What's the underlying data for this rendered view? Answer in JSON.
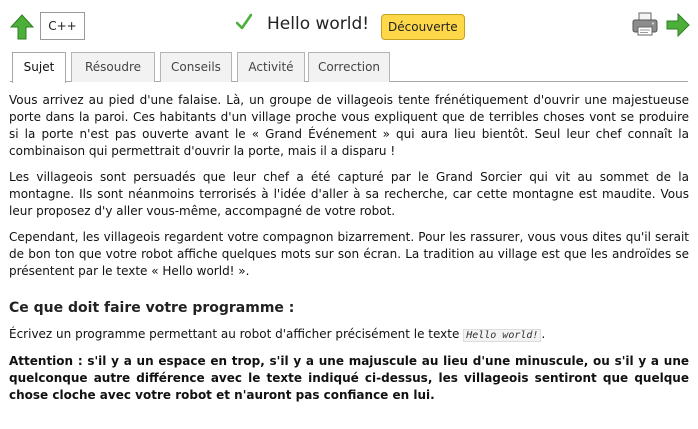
{
  "header": {
    "language": "C++",
    "title": "Hello world!",
    "level_badge": "Découverte"
  },
  "colors": {
    "accent_green": "#4caf3a",
    "badge_yellow": "#ffd84a"
  },
  "icons": {
    "back": "up-arrow-icon",
    "status": "checkmark-icon",
    "print": "printer-icon",
    "next": "next-arrow-icon"
  },
  "tabs": [
    {
      "label": "Sujet",
      "active": true
    },
    {
      "label": "Résoudre",
      "active": false
    },
    {
      "label": "Conseils",
      "active": false
    },
    {
      "label": "Activité",
      "active": false
    },
    {
      "label": "Correction",
      "active": false
    }
  ],
  "content": {
    "paragraphs": [
      "Vous arrivez au pied d'une falaise. Là, un groupe de villageois tente frénétiquement d'ouvrir une majestueuse porte dans la paroi. Ces habitants d'un village proche vous expliquent que de terribles choses vont se produire si la porte n'est pas ouverte avant le « Grand Événement » qui aura lieu bientôt. Seul leur chef connaît la combinaison qui permettrait d'ouvrir la porte, mais il a disparu !",
      "Les villageois sont persuadés que leur chef a été capturé par le Grand Sorcier qui vit au sommet de la montagne. Ils sont néanmoins terrorisés à l'idée d'aller à sa recherche, car cette montagne est maudite. Vous leur proposez d'y aller vous-même, accompagné de votre robot.",
      "Cependant, les villageois regardent votre compagnon bizarrement. Pour les rassurer, vous vous dites qu'il serait de bon ton que votre robot affiche quelques mots sur son écran. La tradition au village est que les androïdes se présentent par le texte « Hello world! »."
    ],
    "section_title": "Ce que doit faire votre programme :",
    "task_prefix": "Écrivez un programme permettant au robot d'afficher précisément le texte ",
    "task_code": "Hello world!",
    "task_suffix": ".",
    "warning": "Attention : s'il y a un espace en trop, s'il y a une majuscule au lieu d'une minuscule, ou s'il y a une quelconque autre différence avec le texte indiqué ci-dessus, les villageois sentiront que quelque chose cloche avec votre robot et n'auront pas confiance en lui."
  }
}
